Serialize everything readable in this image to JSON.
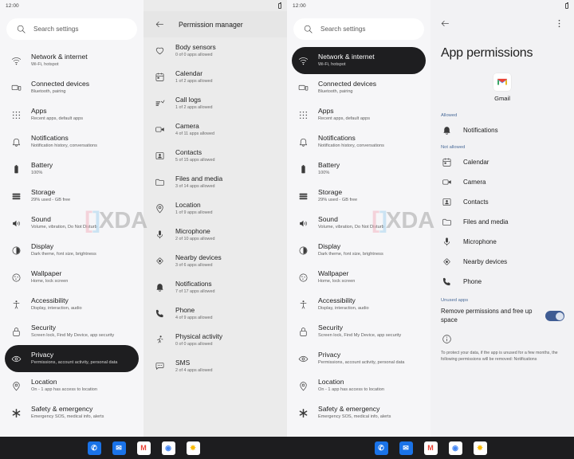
{
  "statusbar": {
    "time": "12:00"
  },
  "search": {
    "placeholder": "Search settings"
  },
  "settings_items": [
    {
      "icon": "wifi-icon",
      "title": "Network & internet",
      "subtitle": "Wi-Fi, hotspot"
    },
    {
      "icon": "devices-icon",
      "title": "Connected devices",
      "subtitle": "Bluetooth, pairing"
    },
    {
      "icon": "apps-grid-icon",
      "title": "Apps",
      "subtitle": "Recent apps, default apps"
    },
    {
      "icon": "bell-icon",
      "title": "Notifications",
      "subtitle": "Notification history, conversations"
    },
    {
      "icon": "battery-icon",
      "title": "Battery",
      "subtitle": "100%"
    },
    {
      "icon": "storage-icon",
      "title": "Storage",
      "subtitle": "29% used -      GB free"
    },
    {
      "icon": "sound-icon",
      "title": "Sound",
      "subtitle": "Volume, vibration, Do Not Disturb"
    },
    {
      "icon": "display-icon",
      "title": "Display",
      "subtitle": "Dark theme, font size, brightness"
    },
    {
      "icon": "wallpaper-icon",
      "title": "Wallpaper",
      "subtitle": "Home, lock screen"
    },
    {
      "icon": "accessibility-icon",
      "title": "Accessibility",
      "subtitle": "Display, interaction, audio"
    },
    {
      "icon": "lock-icon",
      "title": "Security",
      "subtitle": "Screen lock, Find My Device, app security"
    },
    {
      "icon": "privacy-eye-icon",
      "title": "Privacy",
      "subtitle": "Permissions, account activity, personal data"
    },
    {
      "icon": "location-pin-icon",
      "title": "Location",
      "subtitle": "On - 1 app has access to location"
    },
    {
      "icon": "safety-icon",
      "title": "Safety & emergency",
      "subtitle": "Emergency SOS, medical info, alerts"
    }
  ],
  "panel1": {
    "selected_index": 11
  },
  "panel3": {
    "selected_index": 0
  },
  "permission_manager": {
    "back": "back-arrow-icon",
    "title": "Permission manager",
    "items": [
      {
        "icon": "heart-icon",
        "title": "Body sensors",
        "subtitle": "0 of 0 apps allowed"
      },
      {
        "icon": "calendar-icon",
        "title": "Calendar",
        "subtitle": "1 of 2 apps allowed"
      },
      {
        "icon": "call-log-icon",
        "title": "Call logs",
        "subtitle": "1 of 2 apps allowed"
      },
      {
        "icon": "camera-icon",
        "title": "Camera",
        "subtitle": "4 of 11 apps allowed"
      },
      {
        "icon": "contacts-icon",
        "title": "Contacts",
        "subtitle": "5 of 15 apps allowed"
      },
      {
        "icon": "folder-icon",
        "title": "Files and media",
        "subtitle": "3 of 14 apps allowed"
      },
      {
        "icon": "location-pin-icon",
        "title": "Location",
        "subtitle": "1 of 9 apps allowed"
      },
      {
        "icon": "microphone-icon",
        "title": "Microphone",
        "subtitle": "2 of 10 apps allowed"
      },
      {
        "icon": "nearby-icon",
        "title": "Nearby devices",
        "subtitle": "3 of 6 apps allowed"
      },
      {
        "icon": "bell-filled-icon",
        "title": "Notifications",
        "subtitle": "7 of 17 apps allowed"
      },
      {
        "icon": "phone-icon",
        "title": "Phone",
        "subtitle": "4 of 9 apps allowed"
      },
      {
        "icon": "running-icon",
        "title": "Physical activity",
        "subtitle": "0 of 0 apps allowed"
      },
      {
        "icon": "sms-icon",
        "title": "SMS",
        "subtitle": "2 of 4 apps allowed"
      }
    ]
  },
  "app_permissions": {
    "back": "back-arrow-icon",
    "overflow": "more-vert-icon",
    "title": "App permissions",
    "app_name": "Gmail",
    "app_icon": "gmail-icon",
    "allowed_header": "Allowed",
    "allowed": [
      {
        "icon": "bell-filled-icon",
        "title": "Notifications"
      }
    ],
    "not_allowed_header": "Not allowed",
    "not_allowed": [
      {
        "icon": "calendar-icon",
        "title": "Calendar"
      },
      {
        "icon": "camera-icon",
        "title": "Camera"
      },
      {
        "icon": "contacts-icon",
        "title": "Contacts"
      },
      {
        "icon": "folder-icon",
        "title": "Files and media"
      },
      {
        "icon": "microphone-icon",
        "title": "Microphone"
      },
      {
        "icon": "nearby-icon",
        "title": "Nearby devices"
      },
      {
        "icon": "phone-icon",
        "title": "Phone"
      }
    ],
    "unused_header": "Unused apps",
    "unused_toggle_label": "Remove permissions and free up space",
    "unused_toggle_on": true,
    "info_icon": "info-icon",
    "info_text": "To protect your data, if the app is unused for a few months, the following permissions will be removed: Notifications"
  },
  "dock": {
    "apps": [
      {
        "name": "phone-app-icon",
        "glyph": "✆",
        "bg": "#1a73e8",
        "fg": "#ffffff"
      },
      {
        "name": "messages-app-icon",
        "glyph": "✉",
        "bg": "#1a73e8",
        "fg": "#ffffff"
      },
      {
        "name": "gmail-app-icon",
        "glyph": "M",
        "bg": "#ffffff",
        "fg": "#ea4335"
      },
      {
        "name": "chrome-app-icon",
        "glyph": "◉",
        "bg": "#ffffff",
        "fg": "#4285f4"
      },
      {
        "name": "photos-app-icon",
        "glyph": "✸",
        "bg": "#ffffff",
        "fg": "#fbbc04"
      }
    ]
  },
  "watermark": {
    "text": "XDA"
  },
  "colors": {
    "selected_bg": "#1e1e20",
    "accent": "#4a6b99",
    "toggle_on": "#3f5c93",
    "panel_bg": "#f6f6f8",
    "panel2_bg": "#ebebeb"
  }
}
